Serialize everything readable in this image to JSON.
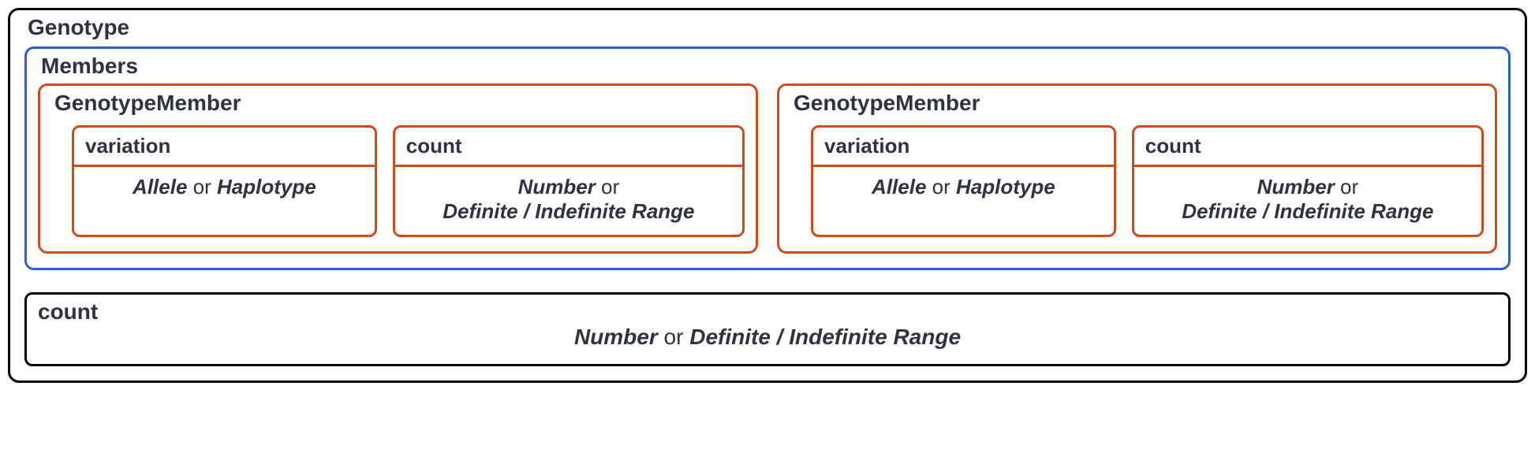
{
  "genotype": {
    "title": "Genotype",
    "members": {
      "title": "Members",
      "items": [
        {
          "title": "GenotypeMember",
          "variation": {
            "label": "variation",
            "value_a": "Allele",
            "or1": " or ",
            "value_b": "Haplotype"
          },
          "count": {
            "label": "count",
            "value_a": "Number",
            "or1": " or",
            "value_b": "Definite / Indefinite Range"
          }
        },
        {
          "title": "GenotypeMember",
          "variation": {
            "label": "variation",
            "value_a": "Allele",
            "or1": " or ",
            "value_b": "Haplotype"
          },
          "count": {
            "label": "count",
            "value_a": "Number",
            "or1": " or",
            "value_b": "Definite / Indefinite Range"
          }
        }
      ]
    },
    "count": {
      "label": "count",
      "value_a": "Number",
      "or1": " or ",
      "value_b": "Definite / Indefinite Range"
    }
  }
}
